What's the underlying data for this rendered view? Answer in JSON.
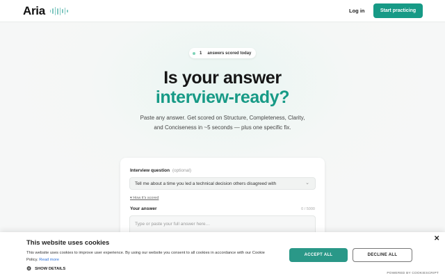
{
  "header": {
    "logo": "Aria",
    "login_label": "Log in",
    "cta_label": "Start practicing"
  },
  "hero": {
    "badge_count": "1",
    "badge_label": "answers scored today",
    "title_line1": "Is your answer",
    "title_line2": "interview-ready?",
    "subtitle": "Paste any answer. Get scored on Structure, Completeness, Clarity, and Conciseness in ~5 seconds — plus one specific fix.",
    "accent_color": "#179a86"
  },
  "form": {
    "question_label": "Interview question",
    "question_optional": "(optional)",
    "question_value": "Tell me about a time you led a technical decision others disagreed with",
    "how_scored_label": "▾ How it's scored",
    "answer_label": "Your answer",
    "answer_counter": "0 / 5000",
    "answer_placeholder": "Type or paste your full answer here…"
  },
  "cookie_banner": {
    "title": "This website uses cookies",
    "text": "This website uses cookies to improve user experience. By using our website you consent to all cookies in accordance with our Cookie Policy.",
    "read_more": "Read more",
    "show_details": "SHOW DETAILS",
    "accept_label": "ACCEPT ALL",
    "decline_label": "DECLINE ALL",
    "powered_by": "POWERED BY COOKIESCRIPT",
    "close_glyph": "✕"
  },
  "icons": {
    "logo_wave": "audio-wave-icon",
    "chevron": "chevron-down-icon",
    "gear": "gear-icon",
    "close": "close-icon"
  }
}
